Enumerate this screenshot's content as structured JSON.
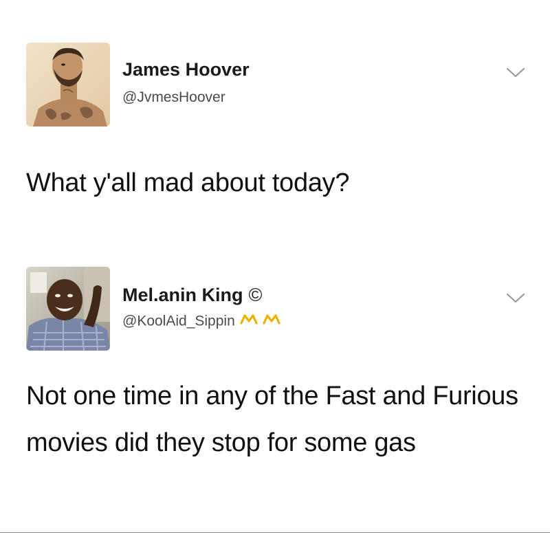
{
  "tweets": [
    {
      "display_name": "James Hoover",
      "handle": "@JvmesHoover",
      "text": "What y'all mad about today?",
      "avatar_icon": "profile-photo-tattooed-man",
      "menu_icon": "chevron-down-icon"
    },
    {
      "display_name": "Mel.anin King",
      "name_badge": "©",
      "handle": "@KoolAid_Sippin",
      "handle_emoji": "crown-icon",
      "text": "Not one time in any of the Fast and Furious movies did they stop for some gas",
      "avatar_icon": "profile-photo-smiling-man",
      "menu_icon": "chevron-down-icon"
    }
  ],
  "colors": {
    "text": "#1a1a1a",
    "handle": "#4a4a4a",
    "chevron": "#9a9a9a",
    "crown": "#e8b400",
    "divider": "#8a8a8a"
  }
}
